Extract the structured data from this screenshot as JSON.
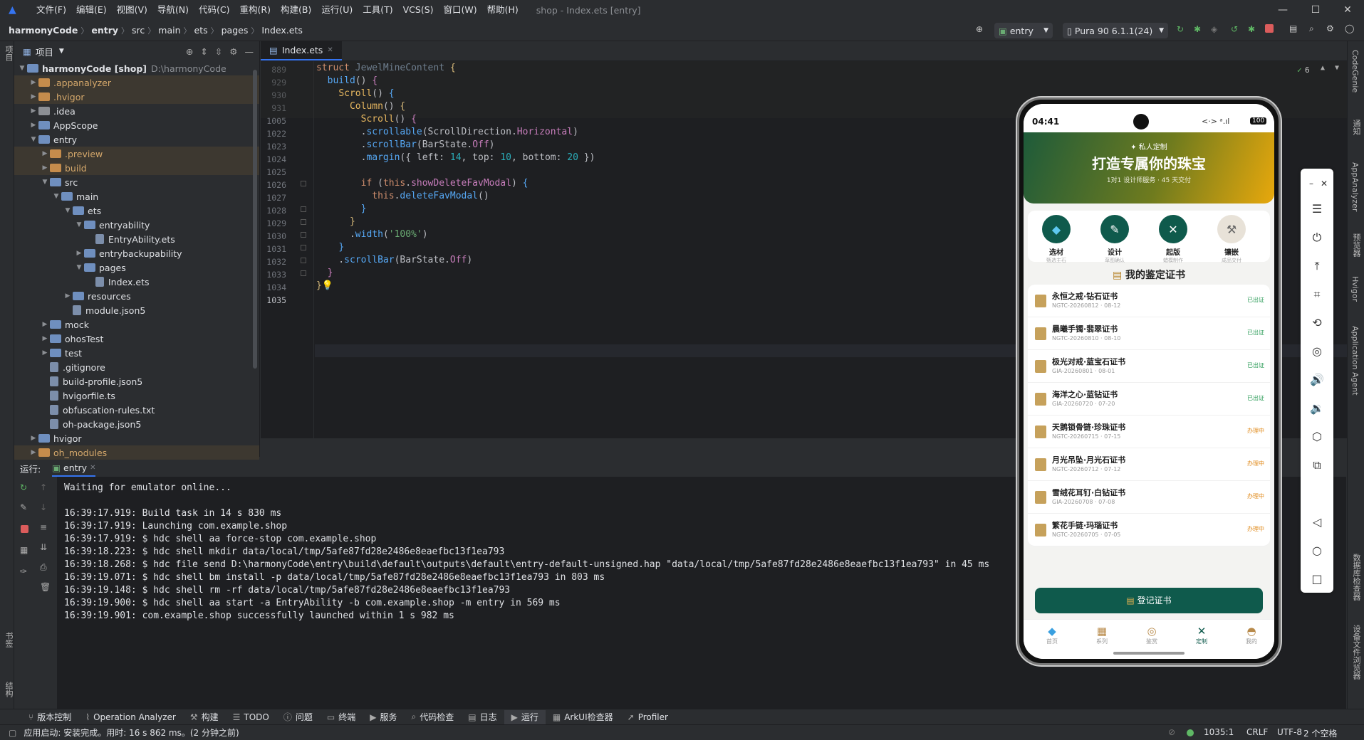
{
  "menu": [
    "文件(F)",
    "编辑(E)",
    "视图(V)",
    "导航(N)",
    "代码(C)",
    "重构(R)",
    "构建(B)",
    "运行(U)",
    "工具(T)",
    "VCS(S)",
    "窗口(W)",
    "帮助(H)"
  ],
  "window_title": "shop - Index.ets [entry]",
  "breadcrumb": [
    "harmonyCode",
    "entry",
    "src",
    "main",
    "ets",
    "pages",
    "Index.ets"
  ],
  "toolbar": {
    "config": "entry",
    "device": "Pura 90 6.1.1(24)"
  },
  "project": {
    "title": "项目",
    "root_name": "harmonyCode [shop]",
    "root_path": "D:\\harmonyCode",
    "tree": [
      ".appanalyzer",
      ".hvigor",
      ".idea",
      "AppScope",
      "entry",
      ".preview",
      "build",
      "src",
      "main",
      "ets",
      "entryability",
      "EntryAbility.ets",
      "entrybackupability",
      "pages",
      "Index.ets",
      "resources",
      "module.json5",
      "mock",
      "ohosTest",
      "test",
      ".gitignore",
      "build-profile.json5",
      "hvigorfile.ts",
      "obfuscation-rules.txt",
      "oh-package.json5",
      "hvigor",
      "oh_modules"
    ]
  },
  "editor": {
    "tab": "Index.ets",
    "inspection_count": "6",
    "line_numbers": [
      "889",
      "929",
      "930",
      "931",
      "1005",
      "1022",
      "1023",
      "1024",
      "1025",
      "1026",
      "1027",
      "1028",
      "1029",
      "1030",
      "1031",
      "1032",
      "1033",
      "1034",
      "1035"
    ]
  },
  "run": {
    "label": "运行:",
    "config": "entry",
    "lines": [
      "Waiting for emulator online...",
      "",
      "16:39:17.919: Build task in 14 s 830 ms",
      "16:39:17.919: Launching com.example.shop",
      "16:39:17.919: $ hdc shell aa force-stop com.example.shop",
      "16:39:18.223: $ hdc shell mkdir data/local/tmp/5afe87fd28e2486e8eaefbc13f1ea793",
      "16:39:18.268: $ hdc file send D:\\harmonyCode\\entry\\build\\default\\outputs\\default\\entry-default-unsigned.hap \"data/local/tmp/5afe87fd28e2486e8eaefbc13f1ea793\" in 45 ms",
      "16:39:19.071: $ hdc shell bm install -p data/local/tmp/5afe87fd28e2486e8eaefbc13f1ea793 in 803 ms",
      "16:39:19.148: $ hdc shell rm -rf data/local/tmp/5afe87fd28e2486e8eaefbc13f1ea793",
      "16:39:19.900: $ hdc shell aa start -a EntryAbility -b com.example.shop -m entry in 569 ms",
      "16:39:19.901: com.example.shop successfully launched within 1 s 982 ms"
    ]
  },
  "bottom_tools": [
    "版本控制",
    "Operation Analyzer",
    "构建",
    "TODO",
    "问题",
    "终端",
    "服务",
    "代码检查",
    "日志",
    "运行",
    "ArkUI检查器",
    "Profiler"
  ],
  "status": {
    "message": "应用启动: 安装完成。用时: 16 s 862 ms。(2 分钟之前)",
    "position": "1035:1",
    "line_sep": "CRLF",
    "encoding": "UTF-8",
    "indent": "2 个空格"
  },
  "right_strip": [
    "CodeGenie",
    "通知",
    "AppAnalyzer",
    "预览器",
    "Hvigor",
    "Application Agent",
    "数据库检查器",
    "设备文件浏览器"
  ],
  "left_strip": [
    "项目",
    "书签",
    "结构"
  ],
  "phone": {
    "time": "04:41",
    "battery": "100",
    "hero_tag": "私人定制",
    "hero_title": "打造专属你的珠宝",
    "hero_sub": "1对1 设计师服务 · 45 天交付",
    "services": [
      {
        "name": "选材",
        "sub": "甄选主石"
      },
      {
        "name": "设计",
        "sub": "草图确认"
      },
      {
        "name": "起版",
        "sub": "蜡模制作"
      },
      {
        "name": "镶嵌",
        "sub": "成品交付"
      }
    ],
    "section_title": "我的鉴定证书",
    "certs": [
      {
        "name": "永恒之戒·钻石证书",
        "code": "NGTC-20260812 · 08-12",
        "status": "已出证",
        "done": true
      },
      {
        "name": "晨曦手镯·翡翠证书",
        "code": "NGTC-20260810 · 08-10",
        "status": "已出证",
        "done": true
      },
      {
        "name": "极光对戒·蓝宝石证书",
        "code": "GIA-20260801 · 08-01",
        "status": "已出证",
        "done": true
      },
      {
        "name": "海洋之心·蓝钻证书",
        "code": "GIA-20260720 · 07-20",
        "status": "已出证",
        "done": true
      },
      {
        "name": "天鹅锁骨链·珍珠证书",
        "code": "NGTC-20260715 · 07-15",
        "status": "办理中",
        "done": false
      },
      {
        "name": "月光吊坠·月光石证书",
        "code": "NGTC-20260712 · 07-12",
        "status": "办理中",
        "done": false
      },
      {
        "name": "雪绒花耳钉·白钻证书",
        "code": "GIA-20260708 · 07-08",
        "status": "办理中",
        "done": false
      },
      {
        "name": "繁花手链·玛瑙证书",
        "code": "NGTC-20260705 · 07-05",
        "status": "办理中",
        "done": false
      }
    ],
    "button": "登记证书",
    "tabs": [
      "首页",
      "系列",
      "鉴赏",
      "定制",
      "我的"
    ],
    "active_tab": "定制"
  },
  "colors": {
    "accent": "#3574f0",
    "brand_green": "#0f5a4c",
    "done": "#2e9d5a",
    "pending": "#e08a1a"
  }
}
